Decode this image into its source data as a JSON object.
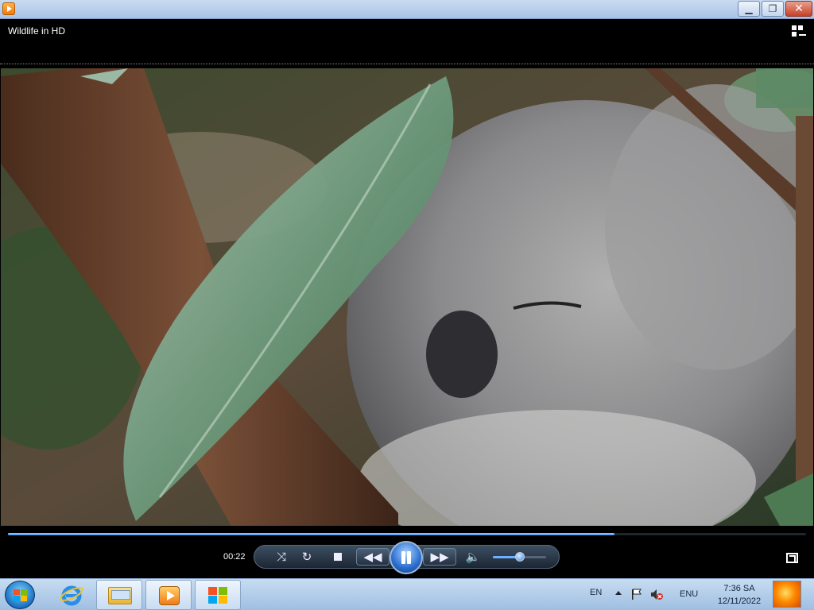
{
  "window": {
    "title": "",
    "controls": [
      "minimize",
      "restore",
      "close"
    ]
  },
  "media": {
    "title": "Wildlife in HD"
  },
  "playback": {
    "elapsed": "00:22",
    "progress_fraction": 0.76,
    "volume_fraction": 0.5,
    "state": "playing"
  },
  "taskbar": {
    "items": [
      "internet-explorer",
      "windows-explorer",
      "windows-media-player",
      "windows-logo"
    ],
    "active_item": "windows-media-player"
  },
  "tray": {
    "language": "EN",
    "input": "ENU",
    "time": "7:36 SA",
    "date": "12/11/2022"
  },
  "colors": {
    "accent": "#2b6dcf",
    "seek_fill": "#4b8ff0"
  }
}
